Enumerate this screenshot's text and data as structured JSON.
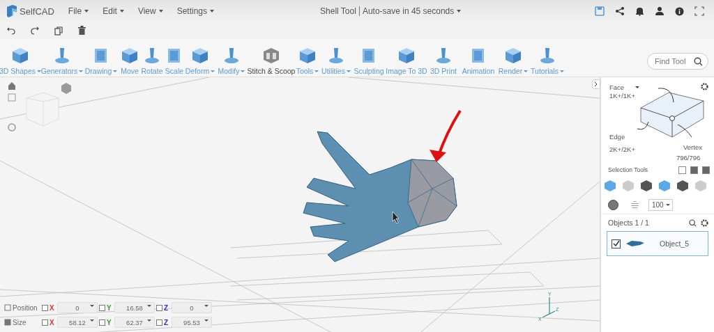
{
  "app": {
    "logo": "SelfCAD",
    "menus": [
      {
        "label": "File"
      },
      {
        "label": "Edit"
      },
      {
        "label": "View"
      },
      {
        "label": "Settings"
      }
    ]
  },
  "title": {
    "tool": "Shell Tool",
    "autosave": "Auto-save in 45 seconds"
  },
  "tools": [
    {
      "label": "3D Shapes",
      "has_menu": true
    },
    {
      "label": "Generators",
      "has_menu": true
    },
    {
      "label": "Drawing",
      "has_menu": true
    },
    {
      "label": "Move",
      "has_menu": false
    },
    {
      "label": "Rotate",
      "has_menu": false
    },
    {
      "label": "Scale",
      "has_menu": false
    },
    {
      "label": "Deform",
      "has_menu": true
    },
    {
      "label": "Modify",
      "has_menu": true
    },
    {
      "label": "Stitch & Scoop",
      "has_menu": false,
      "dark": true
    },
    {
      "label": "Tools",
      "has_menu": true
    },
    {
      "label": "Utilities",
      "has_menu": true
    },
    {
      "label": "Sculpting",
      "has_menu": false
    },
    {
      "label": "Image To 3D",
      "has_menu": false
    },
    {
      "label": "3D Print",
      "has_menu": false
    },
    {
      "label": "Animation",
      "has_menu": false
    },
    {
      "label": "Render",
      "has_menu": true
    },
    {
      "label": "Tutorials",
      "has_menu": true
    }
  ],
  "search": {
    "placeholder": "Find Tool"
  },
  "selection": {
    "face": "Face",
    "face_count": "1K+/1K+",
    "edge": "Edge",
    "edge_count": "2K+/2K+",
    "vertex": "Vertex",
    "vertex_count": "796/796",
    "tools_label": "Selection Tools",
    "brush_size": "100"
  },
  "objects": {
    "label": "Objects 1 / 1",
    "items": [
      {
        "name": "Object_5",
        "checked": true,
        "selected": true
      }
    ]
  },
  "transform": [
    {
      "label": "Position",
      "fields": [
        {
          "axis": "X",
          "value": "0",
          "color": "#e03030",
          "locked": false
        },
        {
          "axis": "Y",
          "value": "16.58",
          "color": "#2e9a2e",
          "locked": false
        },
        {
          "axis": "Z",
          "value": "0",
          "color": "#3030c8",
          "locked": false
        }
      ]
    },
    {
      "label": "Size",
      "fields": [
        {
          "axis": "X",
          "value": "58.12",
          "color": "#e03030",
          "locked": false
        },
        {
          "axis": "Y",
          "value": "62.37",
          "color": "#2e9a2e",
          "locked": false
        },
        {
          "axis": "Z",
          "value": "95.53",
          "color": "#3030c8",
          "locked": false
        }
      ]
    }
  ],
  "gizmo_axes": [
    "Y",
    "X",
    "Z"
  ]
}
